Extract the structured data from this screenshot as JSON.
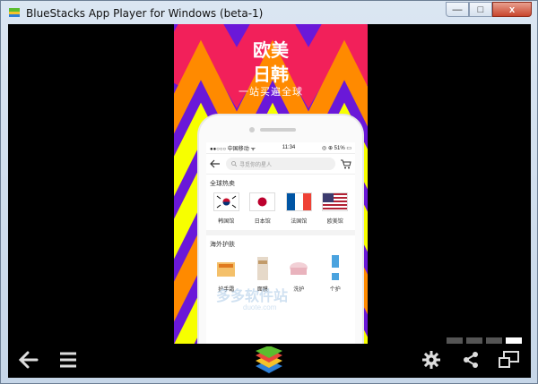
{
  "window": {
    "title": "BlueStacks App Player for Windows (beta-1)",
    "buttons": {
      "minimize": "—",
      "maximize": "□",
      "close": "x"
    }
  },
  "app": {
    "headline_1": "欧美",
    "headline_2": "日韩",
    "tagline": "一站买遍全球",
    "status": {
      "carrier": "●●○○○ 中国移动 ᯤ",
      "time": "11:34",
      "battery": "◎ ⊕ 51% ▭"
    },
    "search_placeholder": "寻觅你的星人",
    "section_hot": "全球热卖",
    "flags": [
      {
        "label": "韩国馆"
      },
      {
        "label": "日本馆"
      },
      {
        "label": "法国馆"
      },
      {
        "label": "欧美馆"
      }
    ],
    "section_skin": "海外护肤",
    "products": [
      {
        "label": "护手霜"
      },
      {
        "label": "面膜"
      },
      {
        "label": "洗护"
      },
      {
        "label": "个护"
      }
    ]
  },
  "watermark": {
    "text": "多多软件站",
    "url": "duote.com"
  },
  "colors": {
    "bg_purple": "#6a18d8",
    "zig_red": "#f2205a",
    "zig_orange": "#ff8a00",
    "zig_yellow": "#f7ff00"
  },
  "icons": {
    "back": "back-arrow-icon",
    "menu": "hamburger-menu-icon",
    "logo": "bluestacks-logo-icon",
    "settings": "gear-icon",
    "share": "share-icon",
    "screen": "screen-toggle-icon"
  }
}
